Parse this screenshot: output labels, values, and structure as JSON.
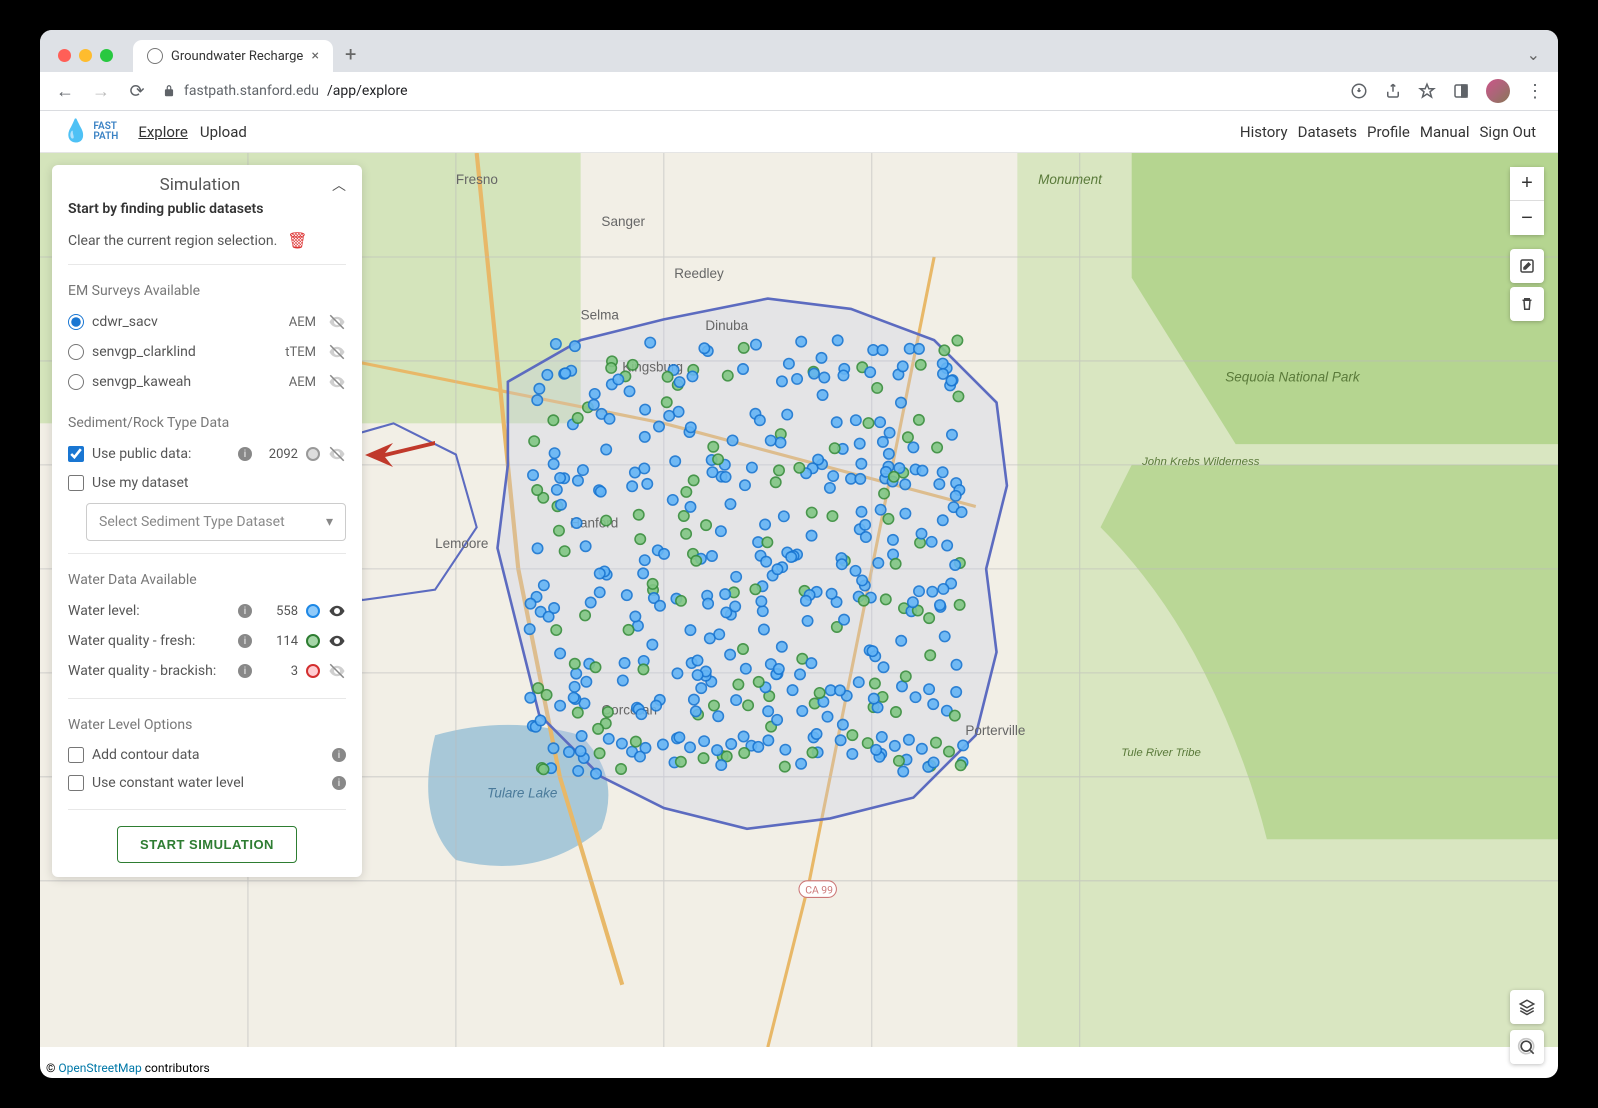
{
  "browser": {
    "tab_title": "Groundwater Recharge",
    "url_host": "fastpath.stanford.edu",
    "url_path": "/app/explore"
  },
  "header": {
    "logo_line1": "FAST",
    "logo_line2": "PATH",
    "nav": {
      "explore": "Explore",
      "upload": "Upload"
    },
    "right_nav": {
      "history": "History",
      "datasets": "Datasets",
      "profile": "Profile",
      "manual": "Manual",
      "signout": "Sign Out"
    }
  },
  "panel": {
    "title": "Simulation",
    "subhead": "Start by finding public datasets",
    "clear_label": "Clear the current region selection.",
    "em_title": "EM Surveys Available",
    "surveys": [
      {
        "name": "cdwr_sacv",
        "type": "AEM",
        "selected": true,
        "hidden": true
      },
      {
        "name": "senvgp_clarklind",
        "type": "tTEM",
        "selected": false,
        "hidden": true
      },
      {
        "name": "senvgp_kaweah",
        "type": "AEM",
        "selected": false,
        "hidden": true
      }
    ],
    "sediment_title": "Sediment/Rock Type Data",
    "use_public": "Use public data:",
    "public_count": "2092",
    "use_my": "Use my dataset",
    "select_placeholder": "Select Sediment Type Dataset",
    "water_title": "Water Data Available",
    "water_level_label": "Water level:",
    "water_level_count": "558",
    "water_fresh_label": "Water quality - fresh:",
    "water_fresh_count": "114",
    "water_brackish_label": "Water quality - brackish:",
    "water_brackish_count": "3",
    "options_title": "Water Level Options",
    "add_contour": "Add contour data",
    "use_constant": "Use constant water level",
    "start_btn": "START SIMULATION"
  },
  "map": {
    "attribution_prefix": "© ",
    "attribution_link": "OpenStreetMap",
    "attribution_suffix": " contributors",
    "visible_labels": {
      "fresno": "Fresno",
      "sanger": "Sanger",
      "selma": "Selma",
      "reedley": "Reedley",
      "dinuba": "Dinuba",
      "kingsburg": "Kingsburg",
      "hanford": "Hanford",
      "lemoore": "Lemoore",
      "corcoran": "Corcoran",
      "porterville": "Porterville",
      "tulare_lake": "Tulare Lake",
      "sequoia": "Sequoia National Park",
      "monument": "Monument",
      "john_krebs": "John Krebs Wilderness",
      "tule_river": "Tule River Tribe",
      "ca99": "CA 99"
    }
  }
}
